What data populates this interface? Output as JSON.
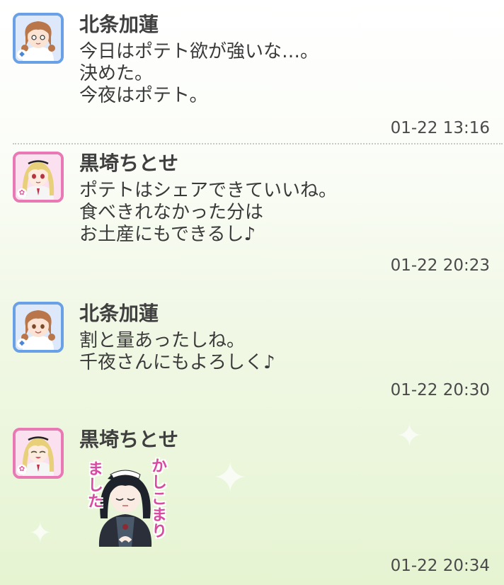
{
  "messages": [
    {
      "sender": "北条加蓮",
      "avatar_icon": "karen-avatar-icon",
      "lines": "今日はポテト欲が強いな…。\n決めた。\n今夜はポテト。",
      "time": "01-22 13:16"
    },
    {
      "sender": "黒埼ちとせ",
      "avatar_icon": "chitose-avatar-icon",
      "lines": "ポテトはシェアできていいね。\n食べきれなかった分は\nお土産にもできるし♪",
      "time": "01-22 20:23"
    },
    {
      "sender": "北条加蓮",
      "avatar_icon": "karen-avatar-icon",
      "lines": "割と量あったしね。\n千夜さんにもよろしく♪",
      "time": "01-22 20:30"
    },
    {
      "sender": "黒埼ちとせ",
      "avatar_icon": "chitose-avatar-icon",
      "sticker": {
        "right_text": "かしこまり",
        "left_text": "ました",
        "icon": "maid-sticker-icon"
      },
      "time": "01-22 20:34"
    }
  ],
  "colors": {
    "karen_frame": "#6aa0e6",
    "chitose_frame": "#e879b5",
    "sticker_text": "#d84aa0"
  }
}
